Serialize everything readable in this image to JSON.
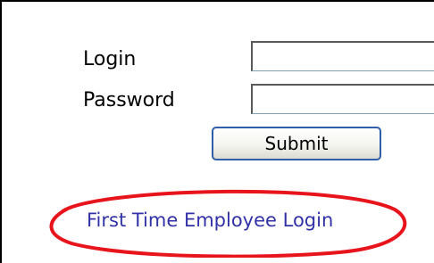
{
  "form": {
    "login_label": "Login",
    "password_label": "Password",
    "login_value": "",
    "password_value": "",
    "submit_label": "Submit"
  },
  "links": {
    "first_time_login": "First Time Employee Login"
  },
  "colors": {
    "link": "#3232a8",
    "highlight": "#e8141c",
    "button_border": "#2f5fa8"
  }
}
